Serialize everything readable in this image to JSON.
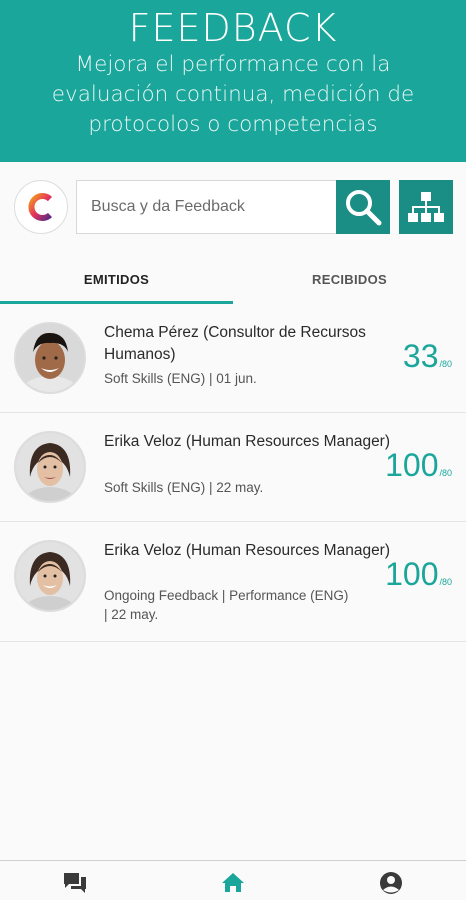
{
  "header": {
    "title": "FEEDBACK",
    "subtitle": "Mejora el performance con la evaluación continua, medición de protocolos o competencias"
  },
  "search": {
    "placeholder": "Busca y da Feedback"
  },
  "tabs": [
    {
      "label": "EMITIDOS",
      "active": true
    },
    {
      "label": "RECIBIDOS",
      "active": false
    }
  ],
  "feedback_items": [
    {
      "name": "Chema Pérez (Consultor de Recursos Humanos)",
      "meta": "Soft Skills  (ENG) | 01 jun.",
      "score": "33",
      "max": "/80"
    },
    {
      "name": "Erika Veloz (Human Resources Manager)",
      "meta": "Soft Skills  (ENG) | 22 may.",
      "score": "100",
      "max": "/80"
    },
    {
      "name": "Erika Veloz (Human Resources Manager)",
      "meta": "Ongoing Feedback | Performance (ENG) | 22 may.",
      "score": "100",
      "max": "/80"
    }
  ],
  "bottom_nav": [
    {
      "icon": "chat-icon"
    },
    {
      "icon": "home-icon",
      "active": true
    },
    {
      "icon": "profile-icon"
    }
  ],
  "colors": {
    "accent": "#1aa69a",
    "accent_dark": "#1a8d84"
  }
}
